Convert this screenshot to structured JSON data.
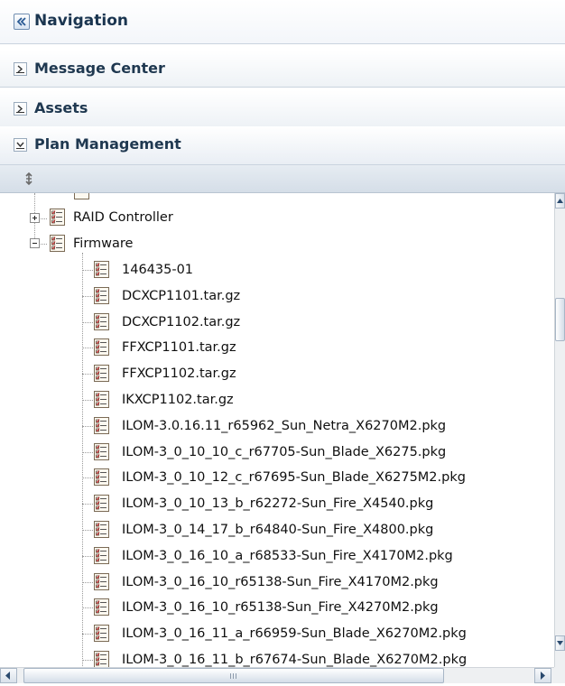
{
  "navigation": {
    "title": "Navigation",
    "collapse_icon": "double-chevron-left-icon"
  },
  "sections": [
    {
      "label": "Message Center",
      "state": "collapsed"
    },
    {
      "label": "Assets",
      "state": "collapsed"
    },
    {
      "label": "Plan Management",
      "state": "expanded"
    }
  ],
  "toolbar": {
    "refresh_icon": "refresh-icon"
  },
  "tree": {
    "raid": {
      "label": "RAID Controller",
      "expander": "plus"
    },
    "firmware": {
      "label": "Firmware",
      "expander": "minus"
    },
    "firmware_items": [
      "146435-01",
      "DCXCP1101.tar.gz",
      "DCXCP1102.tar.gz",
      "FFXCP1101.tar.gz",
      "FFXCP1102.tar.gz",
      "IKXCP1102.tar.gz",
      "ILOM-3.0.16.11_r65962_Sun_Netra_X6270M2.pkg",
      "ILOM-3_0_10_10_c_r67705-Sun_Blade_X6275.pkg",
      "ILOM-3_0_10_12_c_r67695-Sun_Blade_X6275M2.pkg",
      "ILOM-3_0_10_13_b_r62272-Sun_Fire_X4540.pkg",
      "ILOM-3_0_14_17_b_r64840-Sun_Fire_X4800.pkg",
      "ILOM-3_0_16_10_a_r68533-Sun_Fire_X4170M2.pkg",
      "ILOM-3_0_16_10_r65138-Sun_Fire_X4170M2.pkg",
      "ILOM-3_0_16_10_r65138-Sun_Fire_X4270M2.pkg",
      "ILOM-3_0_16_11_a_r66959-Sun_Blade_X6270M2.pkg",
      "ILOM-3_0_16_11_b_r67674-Sun_Blade_X6270M2.pkg"
    ]
  },
  "colors": {
    "title_text": "#1a3550",
    "header_border": "#c9d3de",
    "toolbar_bg": "#dde4ec"
  }
}
